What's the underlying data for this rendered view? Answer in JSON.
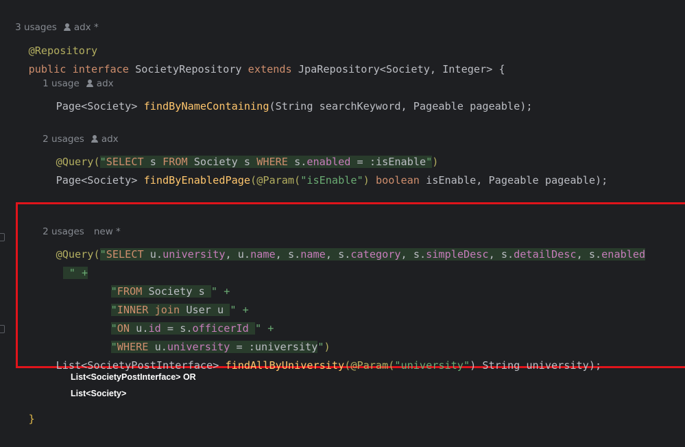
{
  "hints": {
    "h1_usages": "3 usages",
    "h1_author": "adx *",
    "h2_usages": "1 usage",
    "h2_author": "adx",
    "h3_usages": "2 usages",
    "h3_author": "adx",
    "h4_usages": "2 usages",
    "h4_author": "new *"
  },
  "code": {
    "annotation_repository": "@Repository",
    "kw_public": "public",
    "kw_interface": "interface",
    "class_name": "SocietyRepository",
    "kw_extends": "extends",
    "super_type": "JpaRepository<Society, Integer> {",
    "m1_ret": "Page<Society> ",
    "m1_name": "findByNameContaining",
    "m1_args": "(String searchKeyword, Pageable pageable);",
    "q1_ann": "@Query(",
    "q1_str_open": "\"",
    "q1_sql_a": "SELECT",
    "q1_sql_b": " s ",
    "q1_sql_c": "FROM",
    "q1_sql_d": " Society s ",
    "q1_sql_e": "WHERE",
    "q1_sql_f": " s.",
    "q1_sql_g": "enabled",
    "q1_sql_h": " = :isEnable",
    "q1_str_close": "\"",
    "q1_close": ")",
    "m2_ret": "Page<Society> ",
    "m2_name": "findByEnabledPage",
    "m2_param_ann": "(@Param(",
    "m2_param_str": "\"isEnable\"",
    "m2_param_close": ") ",
    "m2_kw_boolean": "boolean",
    "m2_rest": " isEnable, Pageable pageable);",
    "q2_ann": "@Query(",
    "q2_line1_q": "\"",
    "q2_select": "SELECT",
    "q2_line1_rest_1": " u.",
    "q2_f_university": "university",
    "q2_line1_rest_2": ", u.",
    "q2_f_name": "name",
    "q2_line1_rest_3": ", s.",
    "q2_f_sname": "name",
    "q2_line1_rest_4": ", s.",
    "q2_f_category": "category",
    "q2_line1_rest_5": ", s.",
    "q2_f_simple": "simpleDesc",
    "q2_line1_rest_6": ", s.",
    "q2_f_detail": "detailDesc",
    "q2_line1_rest_7": ", s.",
    "q2_f_enabled": "enabled",
    "q2_line2": " \" +",
    "q2_line3_q": "\"",
    "q2_from": "FROM",
    "q2_line3_rest": " Society s ",
    "q2_line3_end": "\" +",
    "q2_line4_q": "\"",
    "q2_inner": "INNER join",
    "q2_line4_rest": " User u ",
    "q2_line4_end": "\" +",
    "q2_line5_q": "\"",
    "q2_on": "ON",
    "q2_line5_rest_1": " u.",
    "q2_f_id": "id",
    "q2_line5_rest_2": " = s.",
    "q2_f_officer": "officerId",
    "q2_line5_rest_3": " ",
    "q2_line5_end": "\" +",
    "q2_line6_q": "\"",
    "q2_where": "WHERE",
    "q2_line6_rest_1": " u.",
    "q2_f_univ2": "university",
    "q2_line6_rest_2": " = :university",
    "q2_line6_end": "\"",
    "q2_close": ")",
    "m3_ret": "List<SocietyPostInterface> ",
    "m3_name": "findAllByUniversity",
    "m3_param_ann": "(@Param(",
    "m3_param_str": "\"university\"",
    "m3_rest": ") String university);",
    "closing_brace": "}"
  },
  "notes": {
    "line1": "List<SocietyPostInterface> OR",
    "line2": "List<Society>"
  },
  "colors": {
    "background": "#1e1f22",
    "highlight_box": "#e0141b",
    "keyword": "#cf8e6d",
    "string": "#6aab73",
    "annotation": "#b3ae60",
    "method": "#56a8f5",
    "field": "#c77dbb"
  }
}
